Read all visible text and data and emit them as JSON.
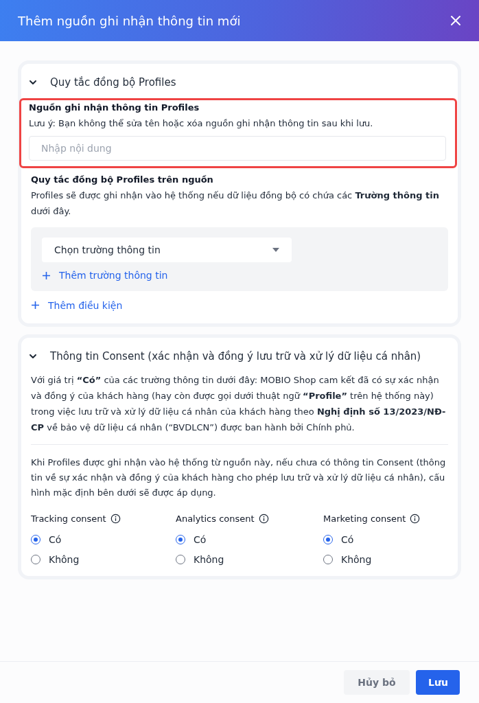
{
  "dialog": {
    "title": "Thêm nguồn ghi nhận thông tin mới"
  },
  "sections": [
    {
      "kind": "rules",
      "title": "Quy tắc đồng bộ Profiles",
      "expanded": true,
      "source_field": {
        "label": "Nguồn ghi nhận thông tin Profiles",
        "note": "Lưu ý: Bạn không thể sửa tên hoặc xóa nguồn ghi nhận thông tin sau khi lưu.",
        "placeholder": "Nhập nội dung",
        "highlighted": true
      },
      "rule": {
        "title": "Quy tắc đồng bộ Profiles trên nguồn",
        "description": "Profiles sẽ được ghi nhận vào hệ thống nếu dữ liệu đồng bộ có chứa các **Trường thông tin** dưới đây.",
        "select": {
          "text": "Chọn trường thông tin"
        },
        "add_field": "Thêm trường thông tin"
      },
      "add_condition": "Thêm điều kiện"
    },
    {
      "kind": "consent",
      "title": "Thông tin Consent (xác nhận và đồng ý lưu trữ và xử lý dữ liệu cá nhân)",
      "expanded": true,
      "intro": "Với giá trị **“Có”** của các trường thông tin dưới đây: MOBIO Shop cam kết đã có sự xác nhận và đồng ý của khách hàng (hay còn được gọi dưới thuật ngữ **“Profile”** trên hệ thống này) trong việc lưu trữ và xử lý dữ liệu cá nhân của khách hàng theo **Nghị định số 13/2023/NĐ-CP** về bảo vệ dữ liệu cá nhân (“BVDLCN”) được ban hành bởi Chính phủ.",
      "note": "Khi Profiles được ghi nhận vào hệ thống từ nguồn này, nếu chưa có thông tin Consent (thông tin về sự xác nhận và đồng ý của khách hàng cho phép lưu trữ và xử lý dữ liệu cá nhân), cấu hình mặc định bên dưới sẽ được áp dụng.",
      "groups": [
        {
          "label": "Tracking consent",
          "options": [
            {
              "label": "Có",
              "selected": true
            },
            {
              "label": "Không",
              "selected": false
            }
          ]
        },
        {
          "label": "Analytics consent",
          "options": [
            {
              "label": "Có",
              "selected": true
            },
            {
              "label": "Không",
              "selected": false
            }
          ]
        },
        {
          "label": "Marketing consent",
          "options": [
            {
              "label": "Có",
              "selected": true
            },
            {
              "label": "Không",
              "selected": false
            }
          ]
        }
      ]
    }
  ],
  "buttons": [
    {
      "label": "Hủy bỏ",
      "kind": "secondary"
    },
    {
      "label": "Lưu",
      "kind": "primary"
    }
  ]
}
